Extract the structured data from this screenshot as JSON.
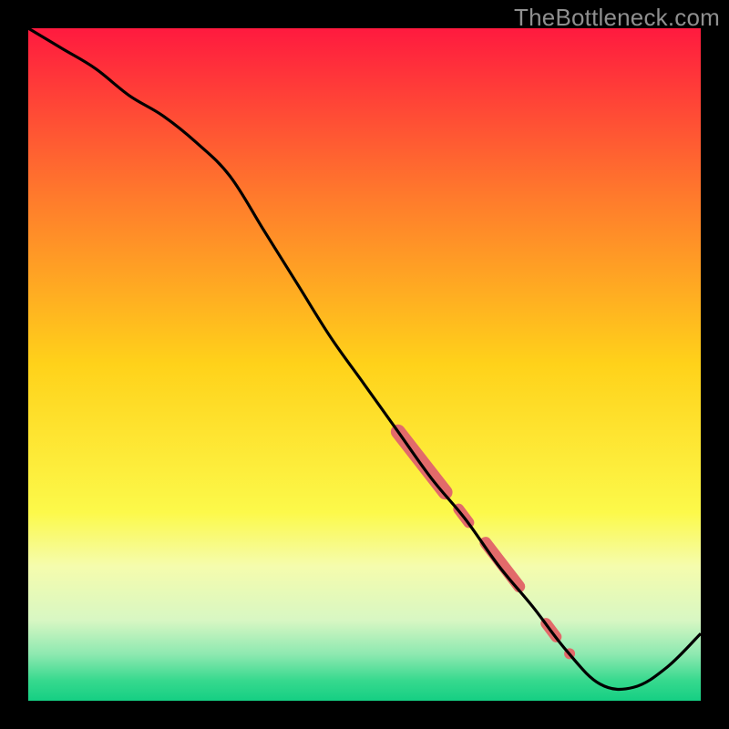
{
  "watermark": "TheBottleneck.com",
  "colors": {
    "curve": "#000000",
    "marker": "#e26a6a",
    "frame": "#000000"
  },
  "chart_data": {
    "type": "line",
    "title": "",
    "xlabel": "",
    "ylabel": "",
    "xlim": [
      0,
      100
    ],
    "ylim": [
      0,
      100
    ],
    "gradient_bands": [
      {
        "y": 0.0,
        "color": "#ff1a3f"
      },
      {
        "y": 25.0,
        "color": "#ff7a2c"
      },
      {
        "y": 50.0,
        "color": "#ffd21a"
      },
      {
        "y": 72.0,
        "color": "#fcf94a"
      },
      {
        "y": 80.0,
        "color": "#f5fcad"
      },
      {
        "y": 88.0,
        "color": "#d8f7c3"
      },
      {
        "y": 93.0,
        "color": "#8fe9b1"
      },
      {
        "y": 97.0,
        "color": "#37d98e"
      },
      {
        "y": 100.0,
        "color": "#15cf83"
      }
    ],
    "curve": {
      "x": [
        0,
        5,
        10,
        15,
        20,
        25,
        30,
        35,
        40,
        45,
        50,
        55,
        60,
        65,
        70,
        75,
        80,
        85,
        90,
        95,
        100
      ],
      "y": [
        100,
        97,
        94,
        90,
        87,
        83,
        78,
        70,
        62,
        54,
        47,
        40,
        33,
        27,
        20,
        14,
        7.5,
        2.5,
        2,
        5,
        10
      ]
    },
    "marker_segments": [
      {
        "x0": 55,
        "y0": 40,
        "x1": 62,
        "y1": 31,
        "w": 16
      },
      {
        "x0": 64,
        "y0": 28.5,
        "x1": 65.5,
        "y1": 26.5,
        "w": 12
      },
      {
        "x0": 68,
        "y0": 23.5,
        "x1": 73,
        "y1": 17,
        "w": 13
      },
      {
        "x0": 77,
        "y0": 11.5,
        "x1": 78.5,
        "y1": 9.5,
        "w": 12
      }
    ],
    "marker_points": [
      {
        "x": 80.5,
        "y": 7,
        "r": 6
      }
    ]
  }
}
